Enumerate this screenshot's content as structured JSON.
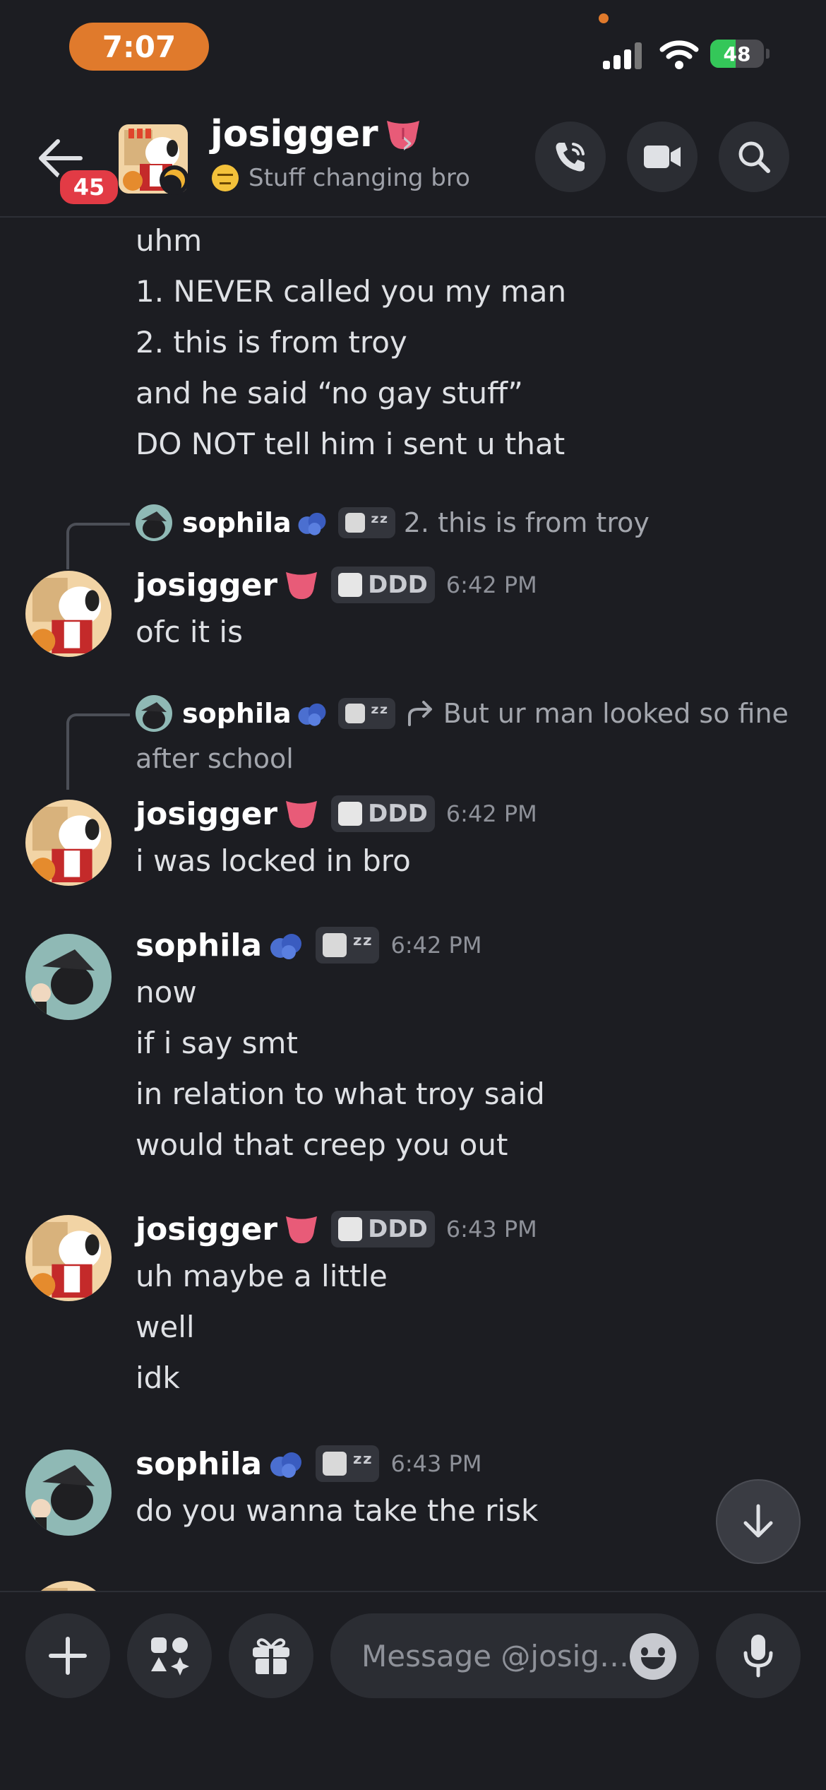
{
  "status_bar": {
    "time": "7:07",
    "battery": "48",
    "battery_level": 0.48
  },
  "header": {
    "name": "josigger",
    "status_text": "Stuff changing bro",
    "unread_badge": "45",
    "chevron": "›",
    "icons": [
      "back-arrow-icon",
      "phone-icon",
      "video-camera-icon",
      "search-icon"
    ]
  },
  "messages": {
    "m0": {
      "lines": [
        "uhm",
        "1.  NEVER called you my man",
        "2.  this is from troy",
        "and he said “no gay stuff”",
        "DO NOT tell him i sent u that"
      ]
    },
    "m1": {
      "reply": {
        "name": "sophila",
        "tag": "ᶻᶻ",
        "text": "2.  this is from troy"
      },
      "author": "josigger",
      "tag": "DDD",
      "time": "6:42 PM",
      "lines": [
        "ofc it is"
      ]
    },
    "m2": {
      "reply": {
        "name": "sophila",
        "tag": "ᶻᶻ",
        "text": "But ur man looked so fine",
        "text2": "after school"
      },
      "author": "josigger",
      "tag": "DDD",
      "time": "6:42 PM",
      "lines": [
        "i was locked in bro"
      ]
    },
    "m3": {
      "author": "sophila",
      "tag": "ᶻᶻ",
      "time": "6:42 PM",
      "lines": [
        "now",
        "if i say smt",
        "in relation to what troy said",
        "would that creep you out"
      ]
    },
    "m4": {
      "author": "josigger",
      "tag": "DDD",
      "time": "6:43 PM",
      "lines": [
        "uh maybe a little",
        "well",
        "idk"
      ]
    },
    "m5": {
      "author": "sophila",
      "tag": "ᶻᶻ",
      "time": "6:43 PM",
      "lines": [
        "do you wanna take the risk"
      ]
    }
  },
  "composer": {
    "placeholder": "Message @josig…",
    "icons": [
      "plus-icon",
      "apps-icon",
      "gift-icon",
      "emoji-icon",
      "microphone-icon"
    ]
  },
  "colors": {
    "background": "#1c1d22",
    "badge": "#e23b45",
    "time_pill": "#e07a2c",
    "battery": "#34c759"
  }
}
